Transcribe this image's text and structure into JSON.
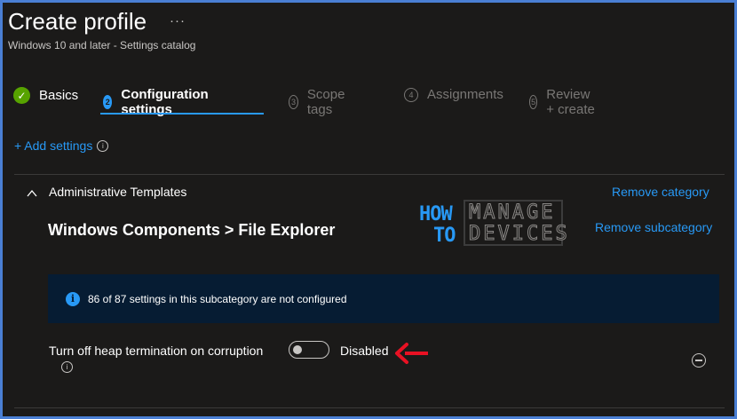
{
  "header": {
    "title": "Create profile",
    "more": "···",
    "subtitle": "Windows 10 and later - Settings catalog"
  },
  "tabs": [
    {
      "label": "Basics",
      "marker": "✓",
      "state": "done"
    },
    {
      "label": "Configuration settings",
      "marker": "2",
      "state": "active"
    },
    {
      "label": "Scope tags",
      "marker": "3",
      "state": "inactive"
    },
    {
      "label": "Assignments",
      "marker": "4",
      "state": "inactive"
    },
    {
      "label": "Review + create",
      "marker": "5",
      "state": "inactive"
    }
  ],
  "add_settings": {
    "label": "+ Add settings",
    "info": "i"
  },
  "category": {
    "label": "Administrative Templates",
    "remove_label": "Remove category",
    "subcategory": "Windows Components > File Explorer",
    "remove_subcategory_label": "Remove subcategory"
  },
  "watermark": {
    "line1a": "HOW",
    "line1b": "MANAGE",
    "line2a": "TO",
    "line2b": "DEVICES"
  },
  "info_banner": {
    "icon": "i",
    "text": "86 of 87 settings in this subcategory are not configured"
  },
  "setting": {
    "label": "Turn off heap termination on corruption",
    "info": "i",
    "enabled": false,
    "state_label": "Disabled"
  },
  "colors": {
    "accent": "#2899f5",
    "success": "#57a300",
    "background": "#1b1a19",
    "banner": "#061c33",
    "annotation_arrow": "#e81123"
  }
}
